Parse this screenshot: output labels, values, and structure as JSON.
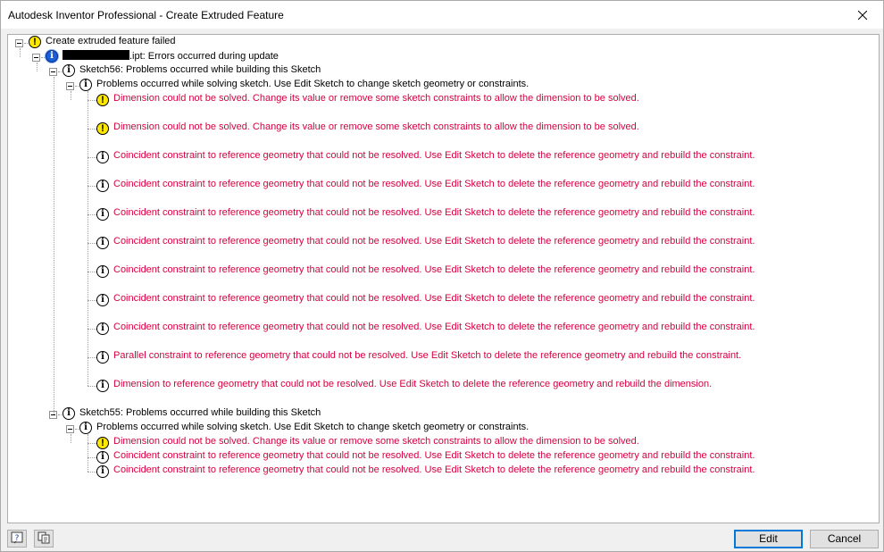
{
  "window": {
    "title": "Autodesk Inventor Professional - Create Extruded Feature",
    "close_glyph": "✕"
  },
  "tree": {
    "root": "Create extruded feature failed",
    "part": {
      "suffix": ".ipt: Errors occurred during update"
    },
    "sketch56": {
      "label": "Sketch56: Problems occurred while building this Sketch",
      "solving": "Problems occurred while solving sketch.  Use Edit Sketch to change sketch geometry or constraints.",
      "items": [
        {
          "icon": "warning-icon",
          "text": "Dimension could not be solved.  Change its value or remove some sketch constraints to allow the dimension to be solved."
        },
        {
          "icon": "warning-icon",
          "text": "Dimension could not be solved.  Change its value or remove some sketch constraints to allow the dimension to be solved."
        },
        {
          "icon": "info-icon",
          "text": "Coincident constraint to reference geometry that could not be resolved.  Use Edit Sketch to delete the reference geometry and rebuild the constraint."
        },
        {
          "icon": "info-icon",
          "text": "Coincident constraint to reference geometry that could not be resolved.  Use Edit Sketch to delete the reference geometry and rebuild the constraint."
        },
        {
          "icon": "info-icon",
          "text": "Coincident constraint to reference geometry that could not be resolved.  Use Edit Sketch to delete the reference geometry and rebuild the constraint."
        },
        {
          "icon": "info-icon",
          "text": "Coincident constraint to reference geometry that could not be resolved.  Use Edit Sketch to delete the reference geometry and rebuild the constraint."
        },
        {
          "icon": "info-icon",
          "text": "Coincident constraint to reference geometry that could not be resolved.  Use Edit Sketch to delete the reference geometry and rebuild the constraint."
        },
        {
          "icon": "info-icon",
          "text": "Coincident constraint to reference geometry that could not be resolved.  Use Edit Sketch to delete the reference geometry and rebuild the constraint."
        },
        {
          "icon": "info-icon",
          "text": "Coincident constraint to reference geometry that could not be resolved.  Use Edit Sketch to delete the reference geometry and rebuild the constraint."
        },
        {
          "icon": "info-icon",
          "text": "Parallel constraint to reference geometry that could not be resolved.  Use Edit Sketch to delete the reference geometry and rebuild the constraint."
        },
        {
          "icon": "info-icon",
          "text": "Dimension to reference geometry that could not be resolved.  Use Edit Sketch to delete the reference geometry and rebuild the dimension."
        }
      ]
    },
    "sketch55": {
      "label": "Sketch55: Problems occurred while building this Sketch",
      "solving": "Problems occurred while solving sketch.  Use Edit Sketch to change sketch geometry or constraints.",
      "items": [
        {
          "icon": "warning-icon",
          "text": "Dimension could not be solved.  Change its value or remove some sketch constraints to allow the dimension to be solved."
        },
        {
          "icon": "info-icon",
          "text": "Coincident constraint to reference geometry that could not be resolved.  Use Edit Sketch to delete the reference geometry and rebuild the constraint."
        },
        {
          "icon": "info-icon",
          "text": "Coincident constraint to reference geometry that could not be resolved.  Use Edit Sketch to delete the reference geometry and rebuild the constraint."
        }
      ]
    }
  },
  "footer": {
    "help_icon": "help-icon",
    "copy_icon": "copy-icon",
    "edit_label": "Edit",
    "cancel_label": "Cancel"
  },
  "colors": {
    "error_text": "#d6003f",
    "warning": "#ffe800",
    "info_blue": "#1a5fd6",
    "default_button_border": "#0078d7"
  }
}
